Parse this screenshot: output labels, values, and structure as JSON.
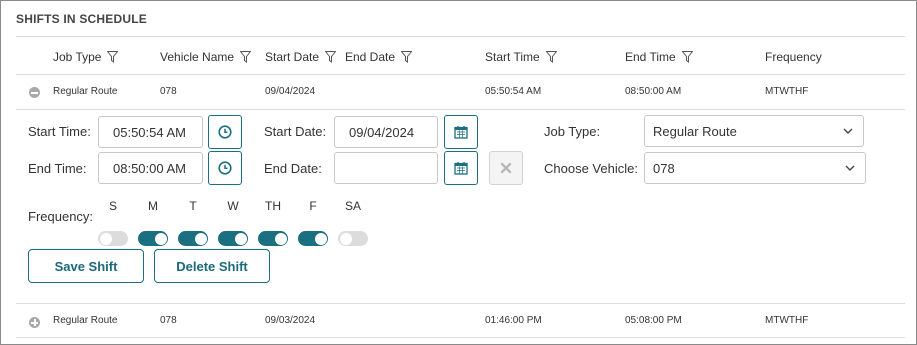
{
  "section": {
    "title": "SHIFTS IN SCHEDULE"
  },
  "columns": [
    {
      "label": "Job Type",
      "filter": true
    },
    {
      "label": "Vehicle Name",
      "filter": true
    },
    {
      "label": "Start Date",
      "filter": true
    },
    {
      "label": "End Date",
      "filter": true
    },
    {
      "label": "Start Time",
      "filter": true
    },
    {
      "label": "End Time",
      "filter": true
    },
    {
      "label": "Frequency",
      "filter": false
    }
  ],
  "rows": [
    {
      "expanded": true,
      "job_type": "Regular Route",
      "vehicle": "078",
      "start_date": "09/04/2024",
      "end_date": "",
      "start_time": "05:50:54 AM",
      "end_time": "08:50:00 AM",
      "frequency": "MTWTHF"
    },
    {
      "expanded": false,
      "job_type": "Regular Route",
      "vehicle": "078",
      "start_date": "09/03/2024",
      "end_date": "",
      "start_time": "01:46:00 PM",
      "end_time": "05:08:00 PM",
      "frequency": "MTWTHF"
    }
  ],
  "form": {
    "start_time_label": "Start Time:",
    "start_time_value": "05:50:54 AM",
    "end_time_label": "End Time:",
    "end_time_value": "08:50:00 AM",
    "start_date_label": "Start Date:",
    "start_date_value": "09/04/2024",
    "end_date_label": "End Date:",
    "end_date_value": "",
    "job_type_label": "Job Type:",
    "job_type_value": "Regular Route",
    "vehicle_label": "Choose Vehicle:",
    "vehicle_value": "078",
    "frequency_label": "Frequency:",
    "days": [
      {
        "label": "S",
        "on": false
      },
      {
        "label": "M",
        "on": true
      },
      {
        "label": "T",
        "on": true
      },
      {
        "label": "W",
        "on": true
      },
      {
        "label": "TH",
        "on": true
      },
      {
        "label": "F",
        "on": true
      },
      {
        "label": "SA",
        "on": false
      }
    ],
    "save_label": "Save Shift",
    "delete_label": "Delete Shift"
  },
  "icons": {
    "filter": "filter-icon",
    "clock": "clock-icon",
    "calendar": "calendar-icon",
    "clear": "clear-x-icon",
    "chevron": "chevron-down-icon",
    "collapse": "collapse-icon",
    "expand": "expand-icon"
  },
  "colors": {
    "accent": "#1a7080",
    "toggle_off": "#dcdcdc",
    "divider": "#dcdcdc"
  }
}
